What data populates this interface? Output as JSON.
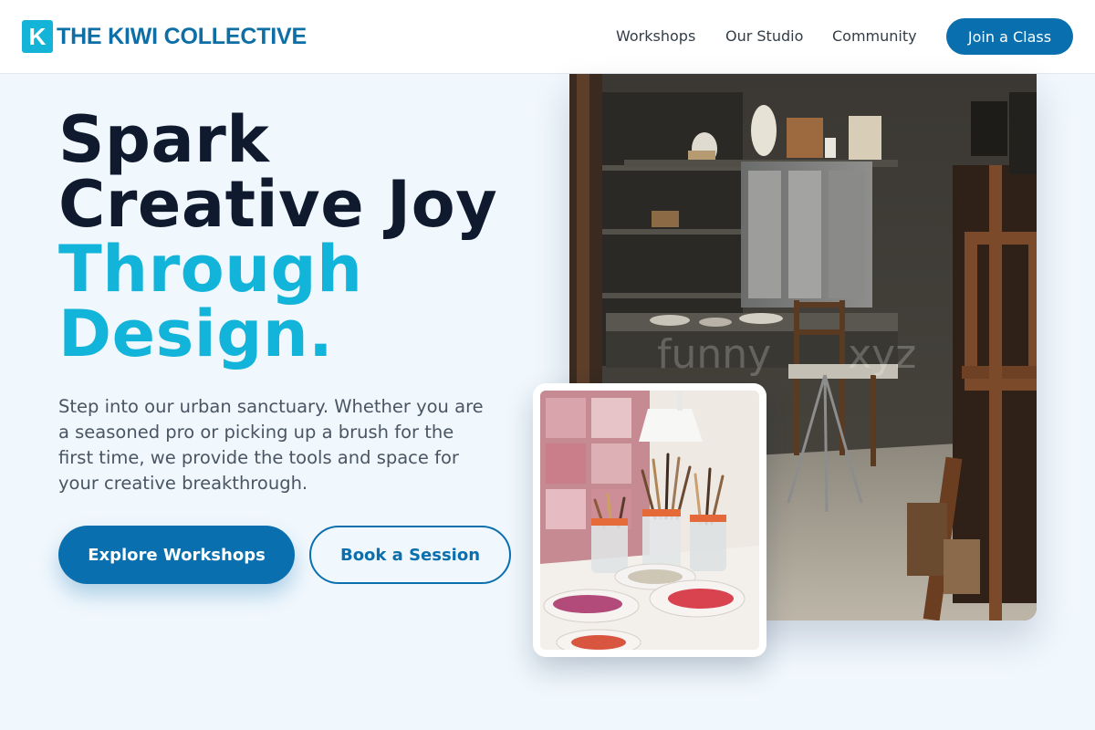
{
  "brand": {
    "logo_letter": "K",
    "name": "THE KIWI COLLECTIVE",
    "accent_color": "#14b4d8",
    "primary_color": "#0a6fae"
  },
  "nav": {
    "items": [
      {
        "label": "Workshops"
      },
      {
        "label": "Our Studio"
      },
      {
        "label": "Community"
      }
    ],
    "cta_label": "Join a Class"
  },
  "hero": {
    "headline_line1": "Spark",
    "headline_line2": "Creative Joy",
    "headline_line3": "Through",
    "headline_line4": "Design.",
    "description": "Step into our urban sanctuary. Whether you are a seasoned pro or picking up a brush for the first time, we provide the tools and space for your creative breakthrough.",
    "primary_button": "Explore Workshops",
    "secondary_button": "Book a Session"
  },
  "images": {
    "main": {
      "icon": "studio-interior-photo",
      "watermark": "funny      xyz"
    },
    "inset": {
      "icon": "paint-brushes-jars-photo"
    }
  }
}
